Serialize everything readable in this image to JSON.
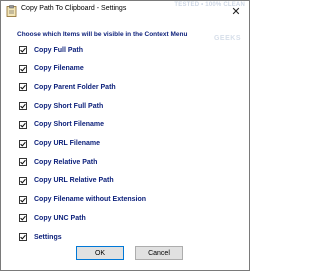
{
  "window": {
    "title": "Copy Path To Clipboard - Settings",
    "close_glyph": "✕",
    "watermark_line1": "TESTED • 100% CLEAN",
    "watermark_line2": "GEEKS"
  },
  "heading": "Choose which Items will be visible in the Context Menu",
  "options": [
    {
      "label": "Copy Full Path",
      "checked": true
    },
    {
      "label": "Copy Filename",
      "checked": true
    },
    {
      "label": "Copy Parent Folder Path",
      "checked": true
    },
    {
      "label": "Copy Short Full Path",
      "checked": true
    },
    {
      "label": "Copy Short Filename",
      "checked": true
    },
    {
      "label": "Copy URL Filename",
      "checked": true
    },
    {
      "label": "Copy Relative Path",
      "checked": true
    },
    {
      "label": "Copy URL Relative Path",
      "checked": true
    },
    {
      "label": "Copy Filename without Extension",
      "checked": true
    },
    {
      "label": "Copy UNC Path",
      "checked": true
    },
    {
      "label": "Settings",
      "checked": true
    }
  ],
  "buttons": {
    "ok_label": "OK",
    "cancel_label": "Cancel"
  },
  "colors": {
    "label_text": "#0b1f7a",
    "ok_border_accent": "#0078d7"
  }
}
